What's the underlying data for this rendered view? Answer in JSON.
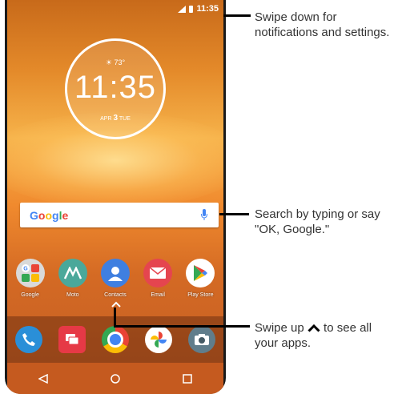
{
  "status_bar": {
    "time": "11:35"
  },
  "clock_widget": {
    "temperature": "73°",
    "time": "11:35",
    "month": "APR",
    "day": "3",
    "weekday": "TUE"
  },
  "search_bar": {
    "brand": "Google"
  },
  "apps": [
    {
      "label": "Google"
    },
    {
      "label": "Moto"
    },
    {
      "label": "Contacts"
    },
    {
      "label": "Email"
    },
    {
      "label": "Play Store"
    }
  ],
  "callouts": {
    "notifications": "Swipe down for notifications and settings.",
    "search": "Search by typing or say \"OK, Google.\"",
    "swipe_up_prefix": "Swipe up",
    "swipe_up_suffix": " to see all your apps."
  },
  "colors": {
    "google_blue": "#4285F4",
    "google_red": "#EA4335",
    "google_yellow": "#FBBC05",
    "google_green": "#34A853"
  }
}
